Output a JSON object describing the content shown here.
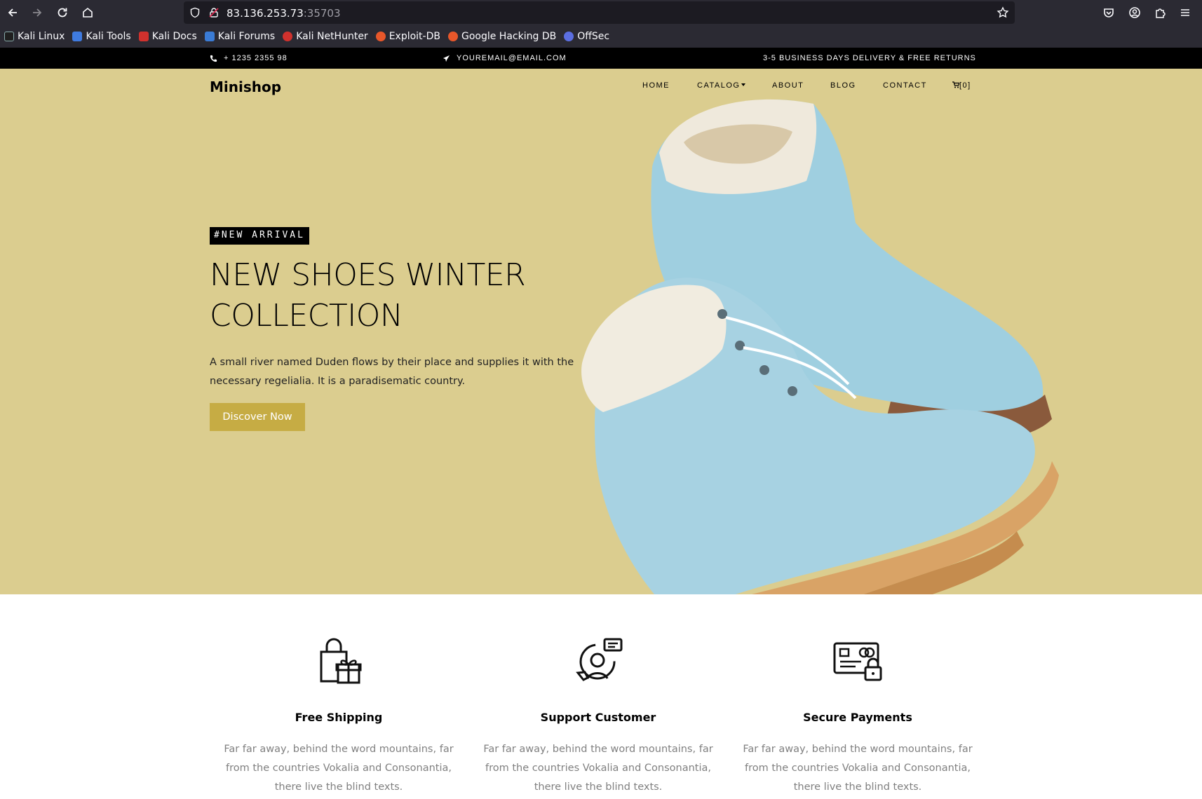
{
  "browser": {
    "url_host": "83.136.253.73",
    "url_port": ":35703",
    "bookmarks": [
      {
        "label": "Kali Linux",
        "color": "#367bf0"
      },
      {
        "label": "Kali Tools",
        "color": "#3f7be0"
      },
      {
        "label": "Kali Docs",
        "color": "#d0312d"
      },
      {
        "label": "Kali Forums",
        "color": "#3a7bd5"
      },
      {
        "label": "Kali NetHunter",
        "color": "#d0312d"
      },
      {
        "label": "Exploit-DB",
        "color": "#e8572a"
      },
      {
        "label": "Google Hacking DB",
        "color": "#e8572a"
      },
      {
        "label": "OffSec",
        "color": "#5b6ee1"
      }
    ]
  },
  "infobar": {
    "phone": "+ 1235 2355 98",
    "email": "YOUREMAIL@EMAIL.COM",
    "delivery": "3-5 BUSINESS DAYS DELIVERY & FREE RETURNS"
  },
  "nav": {
    "brand": "Minishop",
    "home": "HOME",
    "catalog": "CATALOG",
    "about": "ABOUT",
    "blog": "BLOG",
    "contact": "CONTACT",
    "cart": "[0]"
  },
  "hero": {
    "tag": "#NEW ARRIVAL",
    "headline_line1": "NEW SHOES WINTER",
    "headline_line2": "COLLECTION",
    "description": "A small river named Duden flows by their place and supplies it with the necessary regelialia. It is a paradisematic country.",
    "cta": "Discover Now",
    "bg_color": "#dbcd8f",
    "button_color": "#c6ac44"
  },
  "features": [
    {
      "icon": "shopping-bag-gift-icon",
      "title": "Free Shipping",
      "text": "Far far away, behind the word mountains, far from the countries Vokalia and Consonantia, there live the blind texts."
    },
    {
      "icon": "customer-support-icon",
      "title": "Support Customer",
      "text": "Far far away, behind the word mountains, far from the countries Vokalia and Consonantia, there live the blind texts."
    },
    {
      "icon": "secure-card-icon",
      "title": "Secure Payments",
      "text": "Far far away, behind the word mountains, far from the countries Vokalia and Consonantia, there live the blind texts."
    }
  ]
}
